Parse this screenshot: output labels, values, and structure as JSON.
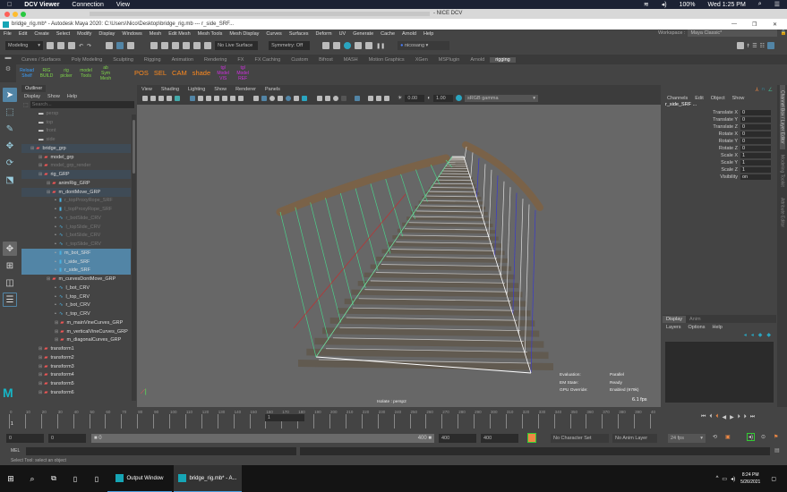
{
  "mac": {
    "app": "DCV Viewer",
    "menus": [
      "Connection",
      "View"
    ],
    "battery": "100%",
    "clock": "Wed 1:25 PM"
  },
  "dcv": {
    "title": "- NICE DCV"
  },
  "maya": {
    "title": "bridge_rig.mb* - Autodesk Maya 2020: C:\\Users\\Nico\\Desktop\\bridge_rig.mb  ---  r_side_SRF...",
    "menus": [
      "File",
      "Edit",
      "Create",
      "Select",
      "Modify",
      "Display",
      "Windows",
      "Mesh",
      "Edit Mesh",
      "Mesh Tools",
      "Mesh Display",
      "Curves",
      "Surfaces",
      "Deform",
      "UV",
      "Generate",
      "Cache",
      "Arnold",
      "Help"
    ],
    "workspace_label": "Workspace :",
    "workspace": "Maya Classic*",
    "status": {
      "menuset": "Modeling",
      "live_surface": "No Live Surface",
      "symmetry": "Symmetry: Off",
      "user": "nicosang"
    },
    "shelf_tabs": [
      "Curves / Surfaces",
      "Poly Modeling",
      "Sculpting",
      "Rigging",
      "Animation",
      "Rendering",
      "FX",
      "FX Caching",
      "Custom",
      "Bifrost",
      "MASH",
      "Motion Graphics",
      "XGen",
      "MSPlugin",
      "Arnold",
      "rigging"
    ],
    "shelf_active": "rigging",
    "shelf_buttons": [
      {
        "label": "Reload Shelf",
        "color": "#3aa0ff"
      },
      {
        "label": "RIG BUILD",
        "color": "#7fd64a"
      },
      {
        "label": "rig picker",
        "color": "#7fd64a"
      },
      {
        "label": "model Tools",
        "color": "#7fd64a"
      },
      {
        "label": "ab Sym Mesh",
        "color": "#7fd64a"
      },
      {
        "label": "POS",
        "color": "#ff8a1e"
      },
      {
        "label": "SEL",
        "color": "#ff8a1e"
      },
      {
        "label": "CAM",
        "color": "#ff8a1e"
      },
      {
        "label": "shade",
        "color": "#ff8a1e"
      },
      {
        "label": "tgl Model VIS",
        "color": "#d030e0"
      },
      {
        "label": "tgl Model REF",
        "color": "#d030e0"
      }
    ]
  },
  "outliner": {
    "title": "Outliner",
    "menus": [
      "Display",
      "Show",
      "Help"
    ],
    "search_placeholder": "Search...",
    "items": [
      {
        "label": "persp",
        "d": 1,
        "t": "cam",
        "s": "dim"
      },
      {
        "label": "top",
        "d": 1,
        "t": "cam",
        "s": "dim"
      },
      {
        "label": "front",
        "d": 1,
        "t": "cam",
        "s": "dim"
      },
      {
        "label": "side",
        "d": 1,
        "t": "cam",
        "s": "dim"
      },
      {
        "label": "bridge_grp",
        "d": 0,
        "t": "grp",
        "s": "hl"
      },
      {
        "label": "model_grp",
        "d": 1,
        "t": "grp",
        "s": ""
      },
      {
        "label": "model_grp_render",
        "d": 1,
        "t": "grp",
        "s": "dim"
      },
      {
        "label": "rig_GRP",
        "d": 1,
        "t": "grp",
        "s": "hl"
      },
      {
        "label": "animRig_GRP",
        "d": 2,
        "t": "grp",
        "s": ""
      },
      {
        "label": "m_dontMove_GRP",
        "d": 2,
        "t": "grp",
        "s": "hl"
      },
      {
        "label": "r_topProxyRope_SRF",
        "d": 3,
        "t": "srf",
        "s": "dim"
      },
      {
        "label": "l_topProxyRope_SRF",
        "d": 3,
        "t": "srf",
        "s": "dim"
      },
      {
        "label": "r_botSlide_CRV",
        "d": 3,
        "t": "crv",
        "s": "dim"
      },
      {
        "label": "l_topSlide_CRV",
        "d": 3,
        "t": "crv",
        "s": "dim"
      },
      {
        "label": "l_botSlide_CRV",
        "d": 3,
        "t": "crv",
        "s": "dim"
      },
      {
        "label": "r_topSlide_CRV",
        "d": 3,
        "t": "crv",
        "s": "dim"
      },
      {
        "label": "m_bot_SRF",
        "d": 3,
        "t": "srf",
        "s": "sel"
      },
      {
        "label": "l_side_SRF",
        "d": 3,
        "t": "srf",
        "s": "sel"
      },
      {
        "label": "r_side_SRF",
        "d": 3,
        "t": "srf",
        "s": "sel"
      },
      {
        "label": "m_curvesDontMove_GRP",
        "d": 2,
        "t": "grp",
        "s": ""
      },
      {
        "label": "l_bot_CRV",
        "d": 3,
        "t": "crv",
        "s": ""
      },
      {
        "label": "l_top_CRV",
        "d": 3,
        "t": "crv",
        "s": ""
      },
      {
        "label": "r_bot_CRV",
        "d": 3,
        "t": "crv",
        "s": ""
      },
      {
        "label": "r_top_CRV",
        "d": 3,
        "t": "crv",
        "s": ""
      },
      {
        "label": "m_mainVineCurves_GRP",
        "d": 3,
        "t": "grp",
        "s": ""
      },
      {
        "label": "m_verticalVineCurves_GRP",
        "d": 3,
        "t": "grp",
        "s": ""
      },
      {
        "label": "m_diagonalCurves_GRP",
        "d": 3,
        "t": "grp",
        "s": ""
      },
      {
        "label": "transform1",
        "d": 1,
        "t": "grp",
        "s": ""
      },
      {
        "label": "transform2",
        "d": 1,
        "t": "grp",
        "s": ""
      },
      {
        "label": "transform3",
        "d": 1,
        "t": "grp",
        "s": ""
      },
      {
        "label": "transform4",
        "d": 1,
        "t": "grp",
        "s": ""
      },
      {
        "label": "transform5",
        "d": 1,
        "t": "grp",
        "s": ""
      },
      {
        "label": "transform6",
        "d": 1,
        "t": "grp",
        "s": ""
      }
    ]
  },
  "viewport": {
    "menus": [
      "View",
      "Shading",
      "Lighting",
      "Show",
      "Renderer",
      "Panels"
    ],
    "exposure": "0.00",
    "gamma": "1.00",
    "color_space": "sRGB gamma",
    "hud": [
      {
        "k": "Evaluation:",
        "v": "Parallel"
      },
      {
        "k": "EM State:",
        "v": "Ready"
      },
      {
        "k": "GPU Override:",
        "v": "Enabled (979k)"
      }
    ],
    "fps": "6.1 fps",
    "camera_label": "Isolate : persp2"
  },
  "channel_box": {
    "menus": [
      "Channels",
      "Edit",
      "Object",
      "Show"
    ],
    "object": "r_side_SRF ...",
    "attrs": [
      {
        "n": "Translate X",
        "v": "0"
      },
      {
        "n": "Translate Y",
        "v": "0"
      },
      {
        "n": "Translate Z",
        "v": "0"
      },
      {
        "n": "Rotate X",
        "v": "0"
      },
      {
        "n": "Rotate Y",
        "v": "0"
      },
      {
        "n": "Rotate Z",
        "v": "0"
      },
      {
        "n": "Scale X",
        "v": "1"
      },
      {
        "n": "Scale Y",
        "v": "1"
      },
      {
        "n": "Scale Z",
        "v": "1"
      },
      {
        "n": "Visibility",
        "v": "on"
      }
    ]
  },
  "layer_editor": {
    "tabs": [
      "Display",
      "Anim"
    ],
    "menus": [
      "Layers",
      "Options",
      "Help"
    ]
  },
  "right_tabs": [
    "Channel Box / Layer Editor",
    "Modeling Toolkit",
    "Attribute Editor"
  ],
  "timeline": {
    "ticks": [
      "0",
      "10",
      "20",
      "30",
      "40",
      "50",
      "60",
      "70",
      "80",
      "90",
      "100",
      "110",
      "120",
      "130",
      "140",
      "150",
      "160",
      "170",
      "180",
      "190",
      "200",
      "210",
      "220",
      "230",
      "240",
      "250",
      "260",
      "270",
      "280",
      "290",
      "300",
      "310",
      "320",
      "330",
      "340",
      "350",
      "360",
      "370",
      "380",
      "390",
      "40"
    ],
    "current_frame": "1",
    "frame_marker": "1"
  },
  "range": {
    "start": "0",
    "anim_start": "0",
    "slider_start": "0",
    "slider_end": "400",
    "end": "400",
    "anim_end": "400",
    "char_set": "No Character Set",
    "anim_layer": "No Anim Layer",
    "fps": "24 fps"
  },
  "mel": {
    "label": "MEL"
  },
  "help_line": "Select Tool: select an object",
  "taskbar": {
    "apps": [
      "Output Window",
      "bridge_rig.mb* - A..."
    ],
    "time": "8:24 PM",
    "date": "5/26/2021"
  }
}
